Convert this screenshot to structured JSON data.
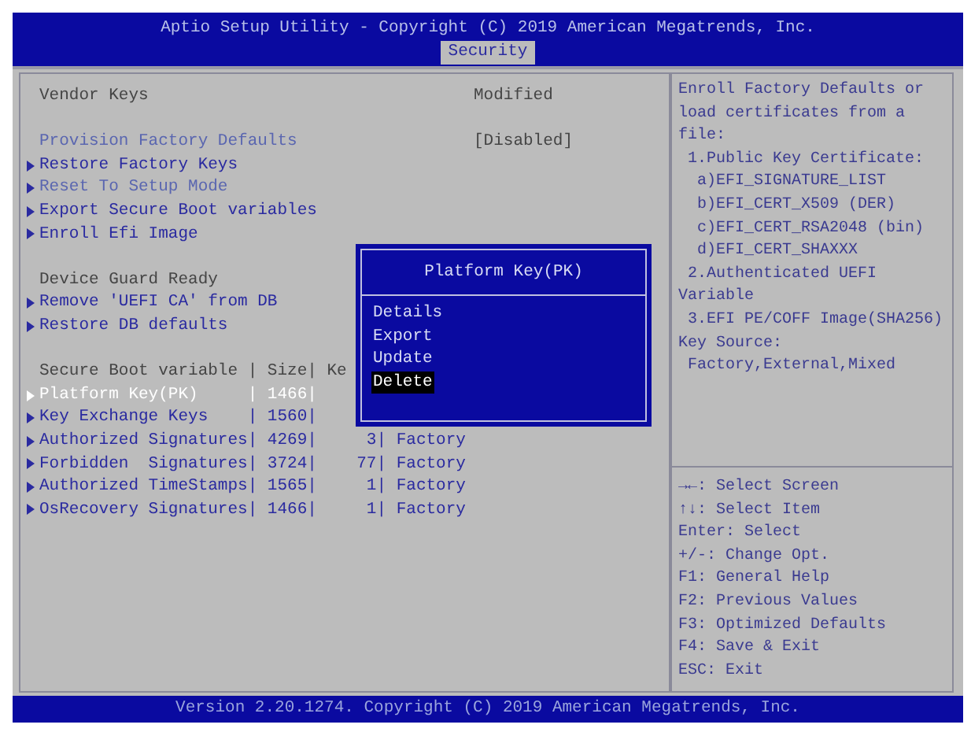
{
  "title_bar": {
    "title": "Aptio Setup Utility - Copyright (C) 2019 American Megatrends, Inc.",
    "tabs": [
      {
        "label": "Security",
        "selected": true
      }
    ]
  },
  "main": {
    "lines": [
      {
        "kind": "label",
        "text": "Vendor Keys",
        "value": "Modified"
      },
      {
        "kind": "blank"
      },
      {
        "kind": "setting",
        "text": "Provision Factory Defaults",
        "value": "[Disabled]"
      },
      {
        "kind": "submenu",
        "text": "Restore Factory Keys",
        "selected": false,
        "dim": false
      },
      {
        "kind": "submenu",
        "text": "Reset To Setup Mode",
        "selected": false,
        "dim": true
      },
      {
        "kind": "submenu",
        "text": "Export Secure Boot variables",
        "selected": false,
        "dim": false
      },
      {
        "kind": "submenu",
        "text": "Enroll Efi Image",
        "selected": false,
        "dim": false
      },
      {
        "kind": "blank"
      },
      {
        "kind": "label",
        "text": "Device Guard Ready"
      },
      {
        "kind": "submenu",
        "text": "Remove 'UEFI CA' from DB",
        "selected": false,
        "dim": false
      },
      {
        "kind": "submenu",
        "text": "Restore DB defaults",
        "selected": false,
        "dim": false
      },
      {
        "kind": "blank"
      },
      {
        "kind": "label",
        "text": "Secure Boot variable | Size| Ke"
      },
      {
        "kind": "submenu",
        "text": "Platform Key(PK)     | 1466|",
        "selected": true,
        "dim": false
      },
      {
        "kind": "submenu",
        "text": "Key Exchange Keys    | 1560|",
        "selected": false,
        "dim": false
      },
      {
        "kind": "submenu",
        "text": "Authorized Signatures| 4269|     3| Factory",
        "selected": false,
        "dim": false
      },
      {
        "kind": "submenu",
        "text": "Forbidden  Signatures| 3724|    77| Factory",
        "selected": false,
        "dim": false
      },
      {
        "kind": "submenu",
        "text": "Authorized TimeStamps| 1565|     1| Factory",
        "selected": false,
        "dim": false
      },
      {
        "kind": "submenu",
        "text": "OsRecovery Signatures| 1466|     1| Factory",
        "selected": false,
        "dim": false
      }
    ]
  },
  "popup": {
    "title": "Platform Key(PK)",
    "items": [
      {
        "label": "Details",
        "selected": false
      },
      {
        "label": "Export",
        "selected": false
      },
      {
        "label": "Update",
        "selected": false
      },
      {
        "label": "Delete",
        "selected": true
      }
    ]
  },
  "help": {
    "lines": [
      "Enroll Factory Defaults or",
      "load certificates from a",
      "file:",
      " 1.Public Key Certificate:",
      "  a)EFI_SIGNATURE_LIST",
      "  b)EFI_CERT_X509 (DER)",
      "  c)EFI_CERT_RSA2048 (bin)",
      "  d)EFI_CERT_SHAXXX",
      " 2.Authenticated UEFI",
      "Variable",
      " 3.EFI PE/COFF Image(SHA256)",
      "Key Source:",
      " Factory,External,Mixed"
    ]
  },
  "keys": [
    "→←: Select Screen",
    "↑↓: Select Item",
    "Enter: Select",
    "+/-: Change Opt.",
    "F1: General Help",
    "F2: Previous Values",
    "F3: Optimized Defaults",
    "F4: Save & Exit",
    "ESC: Exit"
  ],
  "footer": {
    "text": "Version 2.20.1274. Copyright (C) 2019 American Megatrends, Inc."
  }
}
